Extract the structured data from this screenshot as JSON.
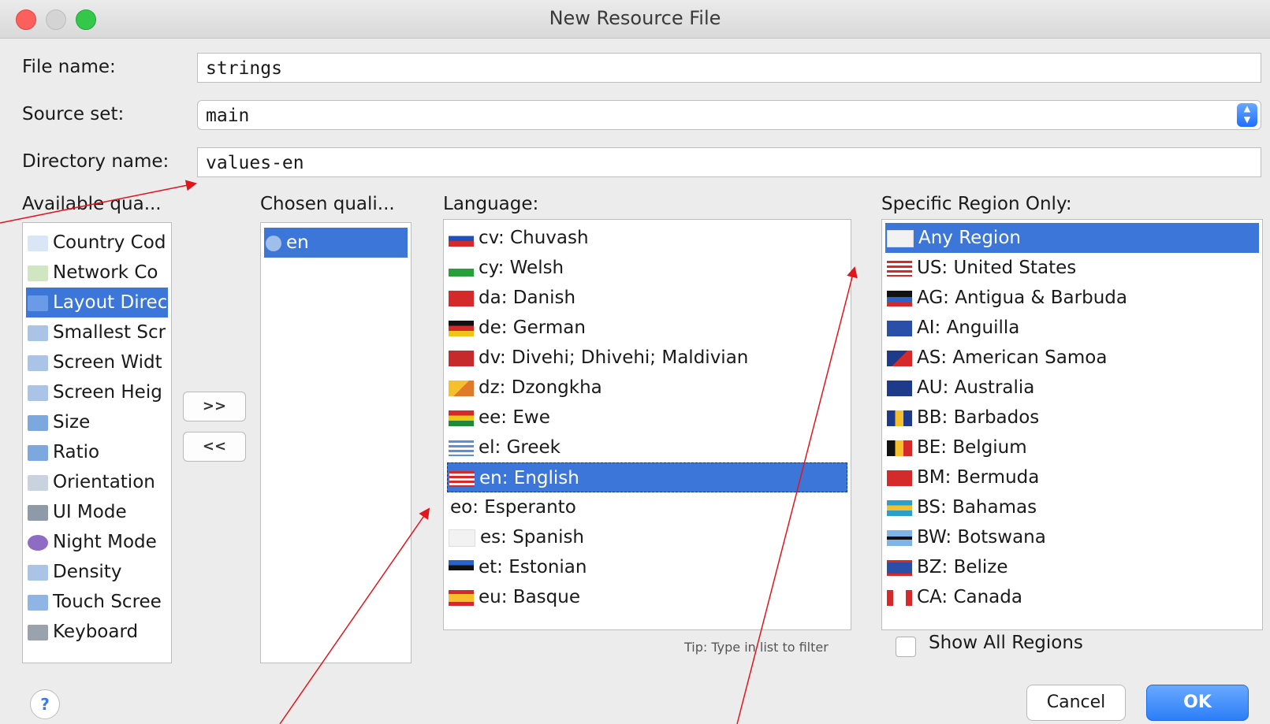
{
  "window": {
    "title": "New Resource File"
  },
  "form": {
    "file_name_label": "File name:",
    "file_name_value": "strings",
    "source_set_label": "Source set:",
    "source_set_value": "main",
    "directory_label": "Directory name:",
    "directory_value": "values-en"
  },
  "available": {
    "header": "Available qua...",
    "items": [
      {
        "label": "Country Cod",
        "icon": "country-code-icon"
      },
      {
        "label": "Network Co",
        "icon": "network-code-icon"
      },
      {
        "label": "Layout Direc",
        "icon": "layout-direction-icon"
      },
      {
        "label": "Smallest Scr",
        "icon": "smallest-screen-icon"
      },
      {
        "label": "Screen Widt",
        "icon": "screen-width-icon"
      },
      {
        "label": "Screen Heig",
        "icon": "screen-height-icon"
      },
      {
        "label": "Size",
        "icon": "size-icon"
      },
      {
        "label": "Ratio",
        "icon": "ratio-icon"
      },
      {
        "label": "Orientation",
        "icon": "orientation-icon"
      },
      {
        "label": "UI Mode",
        "icon": "ui-mode-icon"
      },
      {
        "label": "Night Mode",
        "icon": "night-mode-icon"
      },
      {
        "label": "Density",
        "icon": "density-icon"
      },
      {
        "label": "Touch Scree",
        "icon": "touch-screen-icon"
      },
      {
        "label": "Keyboard",
        "icon": "keyboard-icon"
      }
    ]
  },
  "buttons": {
    "add": ">>",
    "remove": "<<"
  },
  "chosen": {
    "header": "Chosen quali...",
    "items": [
      {
        "label": "en",
        "icon": "globe-icon"
      }
    ]
  },
  "language": {
    "header": "Language:",
    "items": [
      {
        "label": "cv: Chuvash",
        "flag": "chuvash-flag-icon"
      },
      {
        "label": "cy: Welsh",
        "flag": "welsh-flag-icon"
      },
      {
        "label": "da: Danish",
        "flag": "danish-flag-icon"
      },
      {
        "label": "de: German",
        "flag": "german-flag-icon"
      },
      {
        "label": "dv: Divehi; Dhivehi; Maldivian",
        "flag": "maldives-flag-icon"
      },
      {
        "label": "dz: Dzongkha",
        "flag": "bhutan-flag-icon"
      },
      {
        "label": "ee: Ewe",
        "flag": "ghana-flag-icon"
      },
      {
        "label": "el: Greek",
        "flag": "greek-flag-icon"
      },
      {
        "label": "en: English",
        "flag": "us-flag-icon"
      },
      {
        "label": "eo: Esperanto",
        "flag": ""
      },
      {
        "label": "es: Spanish",
        "flag": "blank-flag-icon"
      },
      {
        "label": "et: Estonian",
        "flag": "estonia-flag-icon"
      },
      {
        "label": "eu: Basque",
        "flag": "spain-flag-icon"
      }
    ],
    "tip": "Tip: Type in list to filter"
  },
  "region": {
    "header": "Specific Region Only:",
    "items": [
      {
        "label": "Any Region",
        "flag": "blank-flag-icon"
      },
      {
        "label": "US: United States",
        "flag": "us-flag-icon"
      },
      {
        "label": "AG: Antigua & Barbuda",
        "flag": "antigua-flag-icon"
      },
      {
        "label": "AI: Anguilla",
        "flag": "anguilla-flag-icon"
      },
      {
        "label": "AS: American Samoa",
        "flag": "american-samoa-flag-icon"
      },
      {
        "label": "AU: Australia",
        "flag": "australia-flag-icon"
      },
      {
        "label": "BB: Barbados",
        "flag": "barbados-flag-icon"
      },
      {
        "label": "BE: Belgium",
        "flag": "belgium-flag-icon"
      },
      {
        "label": "BM: Bermuda",
        "flag": "bermuda-flag-icon"
      },
      {
        "label": "BS: Bahamas",
        "flag": "bahamas-flag-icon"
      },
      {
        "label": "BW: Botswana",
        "flag": "botswana-flag-icon"
      },
      {
        "label": "BZ: Belize",
        "flag": "belize-flag-icon"
      },
      {
        "label": "CA: Canada",
        "flag": "canada-flag-icon"
      }
    ],
    "show_all_label": "Show All Regions"
  },
  "footer": {
    "help": "?",
    "cancel": "Cancel",
    "ok": "OK"
  }
}
